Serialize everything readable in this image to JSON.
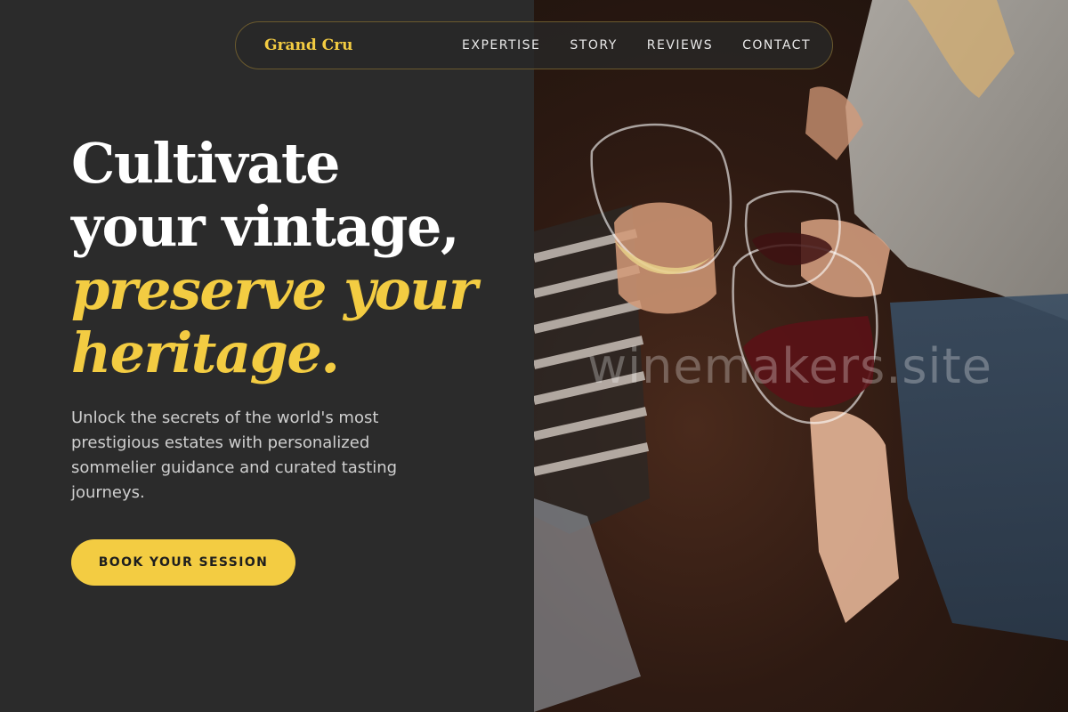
{
  "nav": {
    "brand": "Grand Cru",
    "links": [
      "EXPERTISE",
      "STORY",
      "REVIEWS",
      "CONTACT"
    ]
  },
  "hero": {
    "title_line1": "Cultivate",
    "title_line2": "your vintage,",
    "title_accent_line1": "preserve your",
    "title_accent_line2": "heritage.",
    "subtitle": "Unlock the secrets of the world's most prestigious estates with personalized sommelier guidance and curated tasting journeys.",
    "cta_label": "BOOK YOUR SESSION"
  },
  "photo": {
    "watermark": "winemakers.site"
  },
  "colors": {
    "background": "#2b2b2b",
    "accent": "#f3cc42",
    "text_primary": "#ffffff",
    "text_secondary": "#cfcfcf"
  }
}
